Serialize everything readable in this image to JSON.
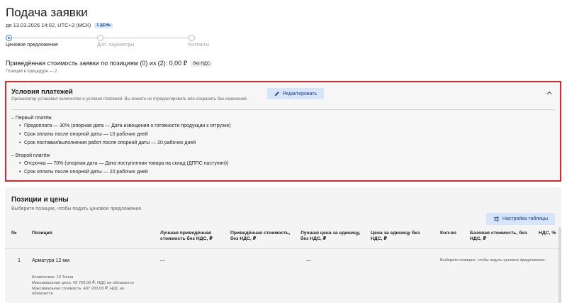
{
  "header": {
    "title": "Подача заявки",
    "deadline": "до 13.03.2026 14:02, UTC+3 (МСК)",
    "deadline_badge": "1 ДЕНЬ"
  },
  "stepper": {
    "steps": [
      {
        "label": "Ценовое предложение"
      },
      {
        "label": "Доп. параметры"
      },
      {
        "label": "Контакты"
      }
    ]
  },
  "summary": {
    "text": "Приведённая стоимость заявки по позициям (0) из (2): 0,00 ₽",
    "vat_badge": "без НДС",
    "positions_count": "Позиций в процедуре — 2"
  },
  "payment_terms": {
    "title": "Условия платежей",
    "description": "Организатор установил количество и условия платежей. Вы можете их отредактировать или сохранить без изменений.",
    "edit_label": "Редактировать",
    "groups": [
      {
        "title": "–  Первый платёж",
        "items": [
          "Предоплата — 30% (опорная дата — Дата извещения о готовности продукции к отгрузке)",
          "Срок оплаты после опорной даты — 10 рабочих дней",
          "Срок поставки/выполнения работ после опорной даты — 20 рабочих дней"
        ]
      },
      {
        "title": "–  Второй платёж",
        "items": [
          "Отсрочка — 70% (опорная дата — Дата поступления товара на склад (ДППС наступил))",
          "Срок оплаты после опорной даты — 20 рабочих дней"
        ]
      }
    ]
  },
  "positions": {
    "title": "Позиции и цены",
    "description": "Выберите позиции, чтобы подать ценовое предложение.",
    "settings_label": "Настройка таблицы",
    "columns": [
      "№",
      "Позиция",
      "Лучшая приведённая стоимость без НДС, ₽",
      "Приведённая стоимость, без НДС, ₽",
      "Лучшая цена за единицу, без НДС, ₽",
      "Цена за единицу без НДС, ₽",
      "Кол-во",
      "Базовая стоимость, без НДС, ₽",
      "НДС, %"
    ],
    "rows": [
      {
        "num": "1",
        "name": "Арматура 12 мм",
        "best_total": "—",
        "best_unit": "—",
        "quantity": "Количество: 10 Тонна",
        "max_price": "Максимальная цена: 43 720,00 ₽, НДС не облагается",
        "max_cost": "Максимальная стоимость: 437 200,00 ₽, НДС не облагается",
        "hint": "Выберите позицию, чтобы подать ценовое предложение."
      }
    ]
  },
  "colors": {
    "accent": "#3b7be0",
    "button_bg": "#d6e5fb",
    "highlight_border": "#d9272e"
  }
}
